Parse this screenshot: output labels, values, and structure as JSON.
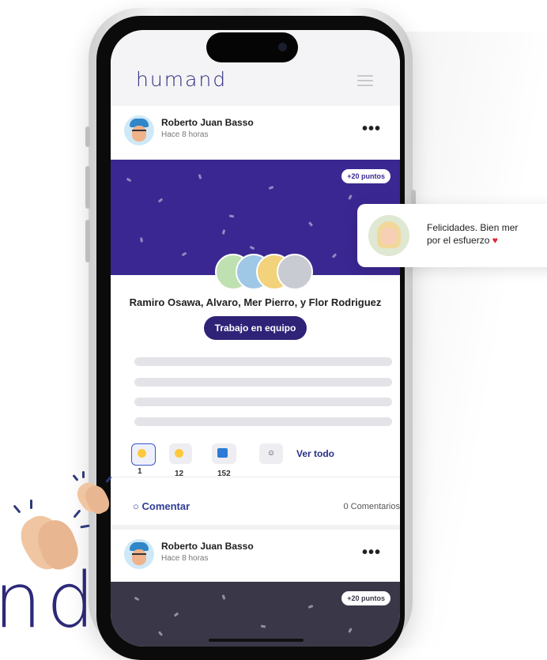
{
  "app": {
    "logo": "humand",
    "brand_fragment": "nd"
  },
  "posts": [
    {
      "author": "Roberto Juan Basso",
      "time": "Hace 8 horas",
      "more": "•••",
      "points": "+20 puntos",
      "recipients": "Ramiro Osawa, Alvaro, Mer Pierro, y Flor Rodriguez",
      "tag": "Trabajo en equipo",
      "reactions": [
        {
          "icon": "smile-emoji-icon",
          "count": "1"
        },
        {
          "icon": "laugh-emoji-icon",
          "count": "12"
        },
        {
          "icon": "blue-square-icon",
          "count": "152"
        }
      ],
      "ver_todo": "Ver todo",
      "comentar": "Comentar",
      "comment_count": "0 Comentarios"
    },
    {
      "author": "Roberto Juan Basso",
      "time": "Hace 8 horas",
      "more": "•••",
      "points": "+20 puntos"
    }
  ],
  "floating_comment": {
    "line1": "Felicidades. Bien mer",
    "line2": "por el esfuerzo"
  },
  "colors": {
    "primary": "#2e2377",
    "banner": "#3b2791",
    "banner_dark": "#3a3848",
    "link": "#2f3d97"
  }
}
